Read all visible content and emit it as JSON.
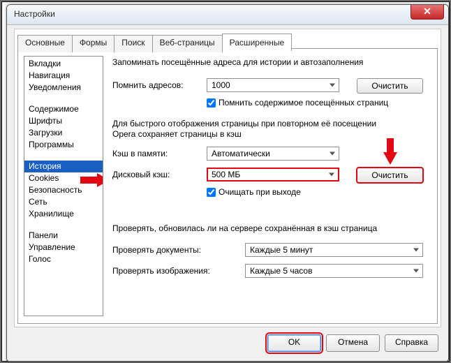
{
  "window": {
    "title": "Настройки"
  },
  "tabs": [
    "Основные",
    "Формы",
    "Поиск",
    "Веб-страницы",
    "Расширенные"
  ],
  "sidebar": {
    "groups": [
      [
        "Вкладки",
        "Навигация",
        "Уведомления"
      ],
      [
        "Содержимое",
        "Шрифты",
        "Загрузки",
        "Программы"
      ],
      [
        "История",
        "Cookies",
        "Безопасность",
        "Сеть",
        "Хранилище"
      ],
      [
        "Панели",
        "Управление",
        "Голос"
      ]
    ],
    "selected": "История"
  },
  "panel": {
    "intro": "Запоминать посещённые адреса для истории и автозаполнения",
    "remember_label": "Помнить адресов:",
    "remember_value": "1000",
    "clear1": "Очистить",
    "remember_chk": "Помнить содержимое посещённых страниц",
    "fast_line1": "Для быстрого отображения страницы при повторном её посещении",
    "fast_line2": "Opera сохраняет страницы в кэш",
    "mem_label": "Кэш в памяти:",
    "mem_value": "Автоматически",
    "disk_label": "Дисковый кэш:",
    "disk_value": "500 МБ",
    "clear2": "Очистить",
    "exit_chk": "Очищать при выходе",
    "check_intro": "Проверять, обновилась ли на сервере сохранённая в кэш страница",
    "docs_label": "Проверять документы:",
    "docs_value": "Каждые 5 минут",
    "imgs_label": "Проверять изображения:",
    "imgs_value": "Каждые 5 часов"
  },
  "buttons": {
    "ok": "OK",
    "cancel": "Отмена",
    "help": "Справка"
  }
}
